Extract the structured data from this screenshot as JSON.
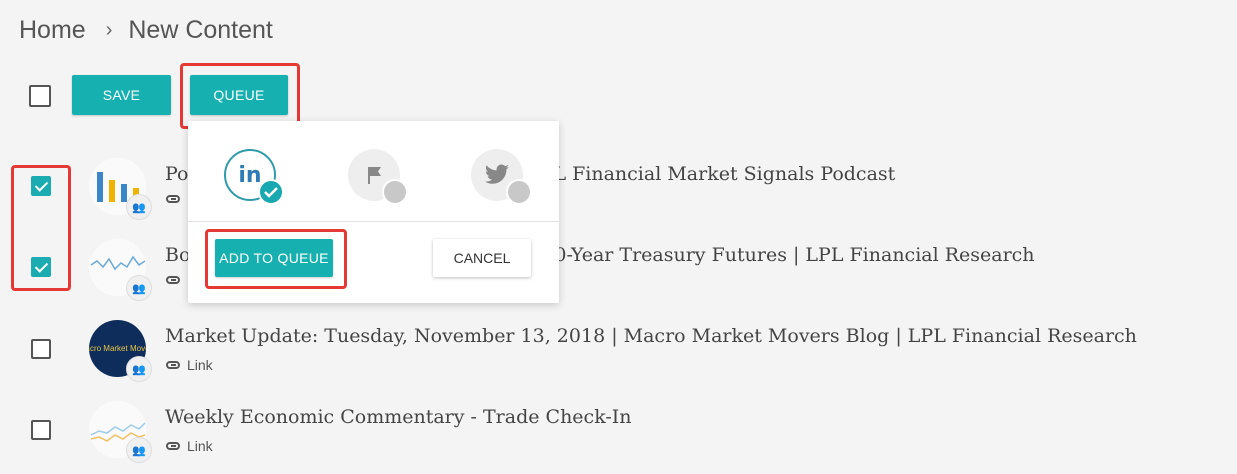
{
  "breadcrumb": {
    "home": "Home",
    "separator": "›",
    "current": "New Content"
  },
  "toolbar": {
    "save_label": "SAVE",
    "queue_label": "QUEUE"
  },
  "rows": [
    {
      "title": "Po",
      "title_tail": "L Financial Market Signals Podcast",
      "link": "Link",
      "checked": true
    },
    {
      "title": "Bo",
      "title_tail": "0-Year Treasury Futures | LPL Financial Research",
      "link": "Link",
      "checked": true
    },
    {
      "title": "Market Update: Tuesday, November 13, 2018 | Macro Market Movers Blog | LPL Financial Research",
      "link": "Link",
      "checked": false,
      "thumb_text": "Macro Market Movers"
    },
    {
      "title": "Weekly Economic Commentary - Trade Check-In",
      "link": "Link",
      "checked": false
    }
  ],
  "popover": {
    "networks": [
      {
        "name": "linkedin",
        "label": "in",
        "selected": true
      },
      {
        "name": "flag",
        "selected": false
      },
      {
        "name": "twitter",
        "selected": false
      }
    ],
    "add_to_queue_label": "ADD TO QUEUE",
    "cancel_label": "CANCEL"
  },
  "colors": {
    "accent": "#17b0b0",
    "highlight": "#e53935",
    "linkedin": "#2f7bb6"
  }
}
